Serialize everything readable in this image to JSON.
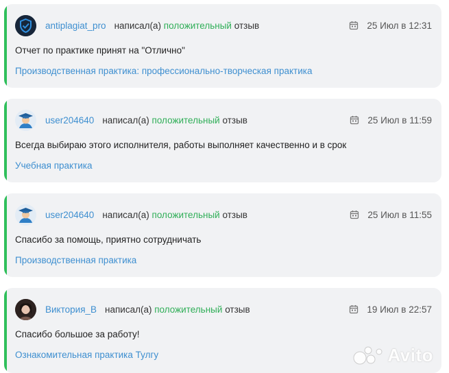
{
  "reviews": [
    {
      "author": "antiplagiat_pro",
      "action_prefix": "написал(а)",
      "action_sentiment": "положительный",
      "action_suffix": "отзыв",
      "date": "25 Июл в 12:31",
      "text": "Отчет по практике принят на \"Отлично\"",
      "subject": "Производственная практика: профессионально-творческая практика",
      "avatar": "shield-logo"
    },
    {
      "author": "user204640",
      "action_prefix": "написал(а)",
      "action_sentiment": "положительный",
      "action_suffix": "отзыв",
      "date": "25 Июл в 11:59",
      "text": "Всегда выбираю этого исполнителя, работы выполняет качественно и в срок",
      "subject": "Учебная практика",
      "avatar": "graduate-avatar"
    },
    {
      "author": "user204640",
      "action_prefix": "написал(а)",
      "action_sentiment": "положительный",
      "action_suffix": "отзыв",
      "date": "25 Июл в 11:55",
      "text": "Спасибо за помощь, приятно сотрудничать",
      "subject": "Производственная практика",
      "avatar": "graduate-avatar"
    },
    {
      "author": "Виктория_В",
      "action_prefix": "написал(а)",
      "action_sentiment": "положительный",
      "action_suffix": "отзыв",
      "date": "19 Июл в 22:57",
      "text": "Спасибо большое за работу!",
      "subject": "Ознакомительная практика Тулгу",
      "avatar": "photo-avatar"
    }
  ],
  "watermark": {
    "text": "Avito",
    "icon": "avito-logo-icon"
  },
  "colors": {
    "accent": "#2fbf5b",
    "link": "#3e8fd0",
    "card": "#f1f2f4"
  }
}
